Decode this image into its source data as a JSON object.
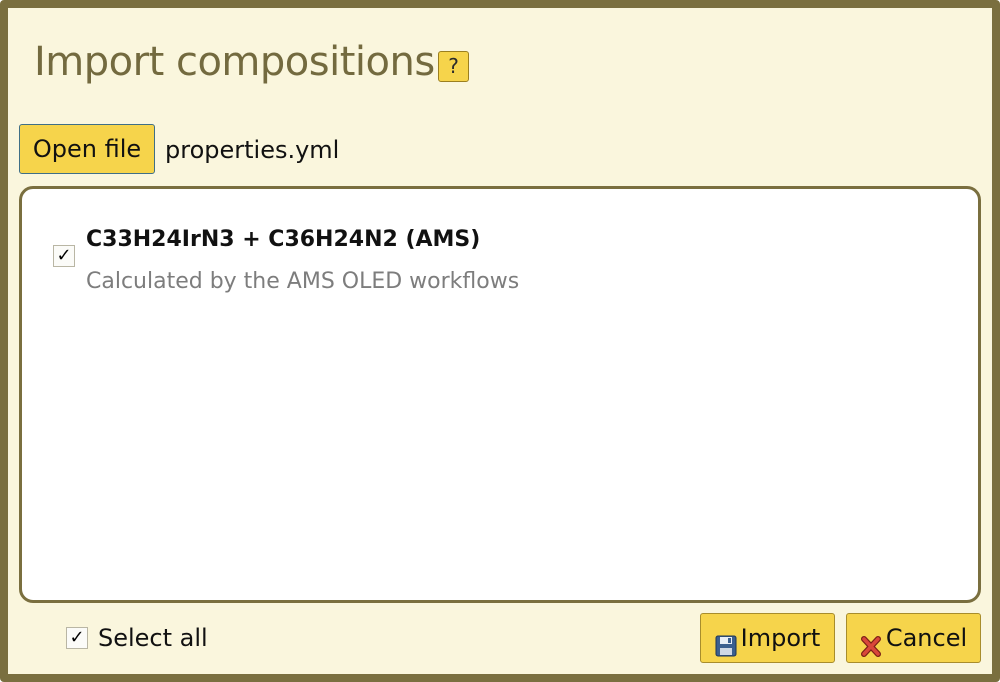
{
  "dialog": {
    "title": "Import compositions",
    "help_label": "?"
  },
  "file": {
    "open_label": "Open file",
    "filename": "properties.yml"
  },
  "items": [
    {
      "checked": true,
      "check_glyph": "✓",
      "title": "C33H24IrN3 + C36H24N2 (AMS)",
      "subtitle": "Calculated by the AMS OLED workflows"
    }
  ],
  "footer": {
    "select_all_checked": true,
    "select_all_glyph": "✓",
    "select_all_label": "Select all",
    "import_label": "Import",
    "import_icon": "floppy-disk-icon",
    "cancel_label": "Cancel",
    "cancel_icon": "red-x-icon"
  },
  "colors": {
    "background": "#faf6dd",
    "frame": "#7a6f3f",
    "title": "#736a3f",
    "button": "#f6d44b"
  }
}
